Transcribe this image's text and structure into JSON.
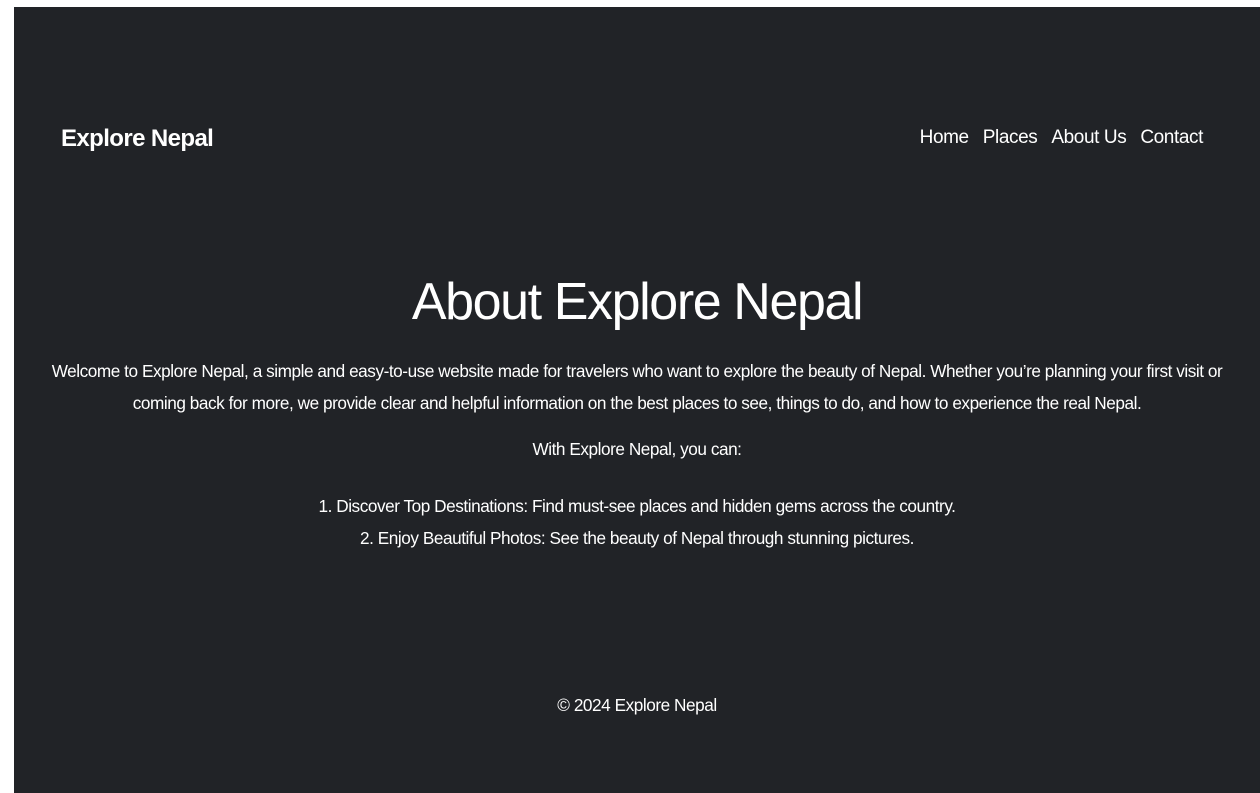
{
  "colors": {
    "background": "#212327",
    "text": "#ffffff"
  },
  "navbar": {
    "brand": "Explore Nepal",
    "links": [
      {
        "label": "Home"
      },
      {
        "label": "Places"
      },
      {
        "label": "About Us"
      },
      {
        "label": "Contact"
      }
    ]
  },
  "main": {
    "title": "About Explore Nepal",
    "intro": "Welcome to Explore Nepal, a simple and easy-to-use website made for travelers who want to explore the beauty of Nepal. Whether you’re planning your first visit or coming back for more, we provide clear and helpful information on the best places to see, things to do, and how to experience the real Nepal.",
    "lead": "With Explore Nepal, you can:",
    "features": [
      "1. Discover Top Destinations: Find must-see places and hidden gems across the country.",
      "2. Enjoy Beautiful Photos: See the beauty of Nepal through stunning pictures."
    ]
  },
  "footer": {
    "text": "© 2024 Explore Nepal"
  }
}
